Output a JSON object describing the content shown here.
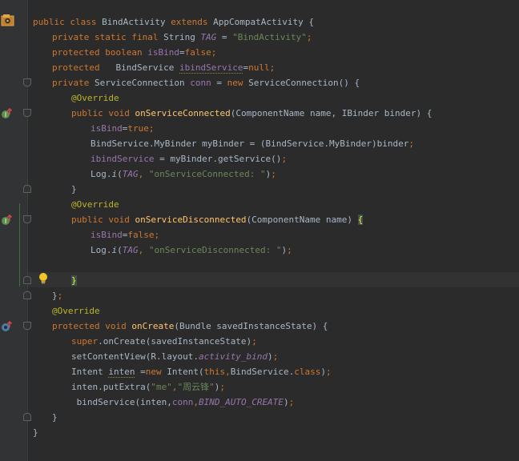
{
  "editor": {
    "lines": [
      {
        "n": 1,
        "indent": 0,
        "tokens": [
          {
            "t": "public class ",
            "c": "kw"
          },
          {
            "t": "BindActivity ",
            "c": ""
          },
          {
            "t": "extends ",
            "c": "kw"
          },
          {
            "t": "AppCompatActivity {",
            "c": ""
          }
        ]
      },
      {
        "n": 2,
        "indent": 1,
        "tokens": [
          {
            "t": "private static final ",
            "c": "kw"
          },
          {
            "t": "String ",
            "c": ""
          },
          {
            "t": "TAG",
            "c": "sfld"
          },
          {
            "t": " = ",
            "c": ""
          },
          {
            "t": "\"BindActivity\"",
            "c": "str"
          },
          {
            "t": ";",
            "c": "kw"
          }
        ]
      },
      {
        "n": 3,
        "indent": 1,
        "tokens": [
          {
            "t": "protected boolean ",
            "c": "kw"
          },
          {
            "t": "isBind",
            "c": "fld"
          },
          {
            "t": "=",
            "c": ""
          },
          {
            "t": "false",
            "c": "kw"
          },
          {
            "t": ";",
            "c": "kw"
          }
        ]
      },
      {
        "n": 4,
        "indent": 1,
        "tokens": [
          {
            "t": "protected   ",
            "c": "kw"
          },
          {
            "t": "BindService ",
            "c": ""
          },
          {
            "t": "ibindService",
            "c": "fld u"
          },
          {
            "t": "=",
            "c": ""
          },
          {
            "t": "null",
            "c": "kw"
          },
          {
            "t": ";",
            "c": "kw"
          }
        ]
      },
      {
        "n": 5,
        "indent": 1,
        "tokens": [
          {
            "t": "private ",
            "c": "kw"
          },
          {
            "t": "ServiceConnection ",
            "c": ""
          },
          {
            "t": "conn",
            "c": "fld"
          },
          {
            "t": " = ",
            "c": ""
          },
          {
            "t": "new ",
            "c": "kw"
          },
          {
            "t": "ServiceConnection() {",
            "c": ""
          }
        ]
      },
      {
        "n": 6,
        "indent": 2,
        "tokens": [
          {
            "t": "@Override",
            "c": "ann"
          }
        ]
      },
      {
        "n": 7,
        "indent": 2,
        "tokens": [
          {
            "t": "public void ",
            "c": "kw"
          },
          {
            "t": "onServiceConnected",
            "c": "fn"
          },
          {
            "t": "(ComponentName name, IBinder binder) {",
            "c": ""
          }
        ]
      },
      {
        "n": 8,
        "indent": 3,
        "tokens": [
          {
            "t": "isBind",
            "c": "fld"
          },
          {
            "t": "=",
            "c": ""
          },
          {
            "t": "true",
            "c": "kw"
          },
          {
            "t": ";",
            "c": "kw"
          }
        ]
      },
      {
        "n": 9,
        "indent": 3,
        "tokens": [
          {
            "t": "BindService.MyBinder myBinder = (BindService.MyBinder)binder",
            "c": ""
          },
          {
            "t": ";",
            "c": "kw"
          }
        ]
      },
      {
        "n": 10,
        "indent": 3,
        "tokens": [
          {
            "t": "ibindService",
            "c": "fld"
          },
          {
            "t": " = myBinder.getService()",
            "c": ""
          },
          {
            "t": ";",
            "c": "kw"
          }
        ]
      },
      {
        "n": 11,
        "indent": 3,
        "tokens": [
          {
            "t": "Log.",
            "c": ""
          },
          {
            "t": "i",
            "c": "it"
          },
          {
            "t": "(",
            "c": ""
          },
          {
            "t": "TAG",
            "c": "sfld"
          },
          {
            "t": ", ",
            "c": "kw"
          },
          {
            "t": "\"onServiceConnected: \"",
            "c": "str"
          },
          {
            "t": ")",
            "c": ""
          },
          {
            "t": ";",
            "c": "kw"
          }
        ]
      },
      {
        "n": 12,
        "indent": 2,
        "tokens": [
          {
            "t": "}",
            "c": ""
          }
        ]
      },
      {
        "n": 13,
        "indent": 2,
        "tokens": [
          {
            "t": "@Override",
            "c": "ann"
          }
        ]
      },
      {
        "n": 14,
        "indent": 2,
        "tokens": [
          {
            "t": "public void ",
            "c": "kw"
          },
          {
            "t": "onServiceDisconnected",
            "c": "fn"
          },
          {
            "t": "(ComponentName name) ",
            "c": ""
          },
          {
            "t": "{",
            "c": "bracehl"
          }
        ]
      },
      {
        "n": 15,
        "indent": 3,
        "tokens": [
          {
            "t": "isBind",
            "c": "fld"
          },
          {
            "t": "=",
            "c": ""
          },
          {
            "t": "false",
            "c": "kw"
          },
          {
            "t": ";",
            "c": "kw"
          }
        ]
      },
      {
        "n": 16,
        "indent": 3,
        "tokens": [
          {
            "t": "Log.",
            "c": ""
          },
          {
            "t": "i",
            "c": "it"
          },
          {
            "t": "(",
            "c": ""
          },
          {
            "t": "TAG",
            "c": "sfld"
          },
          {
            "t": ", ",
            "c": "kw"
          },
          {
            "t": "\"onServiceDisconnected: \"",
            "c": "str"
          },
          {
            "t": ")",
            "c": ""
          },
          {
            "t": ";",
            "c": "kw"
          }
        ]
      },
      {
        "n": 17,
        "indent": 0,
        "tokens": []
      },
      {
        "n": 18,
        "indent": 2,
        "tokens": [
          {
            "t": "}",
            "c": "bracehl"
          }
        ]
      },
      {
        "n": 19,
        "indent": 1,
        "tokens": [
          {
            "t": "}",
            "c": ""
          },
          {
            "t": ";",
            "c": "kw"
          }
        ]
      },
      {
        "n": 20,
        "indent": 1,
        "tokens": [
          {
            "t": "@Override",
            "c": "ann"
          }
        ]
      },
      {
        "n": 21,
        "indent": 1,
        "tokens": [
          {
            "t": "protected void ",
            "c": "kw"
          },
          {
            "t": "onCreate",
            "c": "fn"
          },
          {
            "t": "(Bundle savedInstanceState) {",
            "c": ""
          }
        ]
      },
      {
        "n": 22,
        "indent": 2,
        "tokens": [
          {
            "t": "super",
            "c": "kw"
          },
          {
            "t": ".onCreate(savedInstanceState)",
            "c": ""
          },
          {
            "t": ";",
            "c": "kw"
          }
        ]
      },
      {
        "n": 23,
        "indent": 2,
        "tokens": [
          {
            "t": "setContentView(R.layout.",
            "c": ""
          },
          {
            "t": "activity_bind",
            "c": "sfld"
          },
          {
            "t": ")",
            "c": ""
          },
          {
            "t": ";",
            "c": "kw"
          }
        ]
      },
      {
        "n": 24,
        "indent": 2,
        "tokens": [
          {
            "t": "Intent ",
            "c": ""
          },
          {
            "t": "inten",
            "c": "u"
          },
          {
            "t": " =",
            "c": ""
          },
          {
            "t": "new ",
            "c": "kw"
          },
          {
            "t": "Intent(",
            "c": ""
          },
          {
            "t": "this,",
            "c": "kw"
          },
          {
            "t": "BindService.",
            "c": ""
          },
          {
            "t": "class",
            "c": "kw"
          },
          {
            "t": ")",
            "c": ""
          },
          {
            "t": ";",
            "c": "kw"
          }
        ]
      },
      {
        "n": 25,
        "indent": 2,
        "tokens": [
          {
            "t": "inten.putExtra(",
            "c": ""
          },
          {
            "t": "\"me\"",
            "c": "str"
          },
          {
            "t": ",",
            "c": "kw"
          },
          {
            "t": "\"周云锋\"",
            "c": "str"
          },
          {
            "t": ")",
            "c": ""
          },
          {
            "t": ";",
            "c": "kw"
          }
        ]
      },
      {
        "n": 26,
        "indent": 2,
        "tokens": [
          {
            "t": " bindService(inten,",
            "c": ""
          },
          {
            "t": "conn",
            "c": "fld"
          },
          {
            "t": ",",
            "c": "kw"
          },
          {
            "t": "BIND_AUTO_CREATE",
            "c": "sfld"
          },
          {
            "t": ")",
            "c": ""
          },
          {
            "t": ";",
            "c": "kw"
          }
        ]
      },
      {
        "n": 27,
        "indent": 1,
        "tokens": [
          {
            "t": "}",
            "c": ""
          }
        ]
      },
      {
        "n": 28,
        "indent": 0,
        "tokens": [
          {
            "t": "}",
            "c": ""
          }
        ]
      }
    ]
  },
  "gutter": {
    "class_icon": "class-file-icon",
    "implements_icon_1": "implements-method-icon",
    "implements_icon_2": "implements-method-icon",
    "override_icon": "override-method-icon",
    "intention_icon": "lightbulb-icon"
  }
}
